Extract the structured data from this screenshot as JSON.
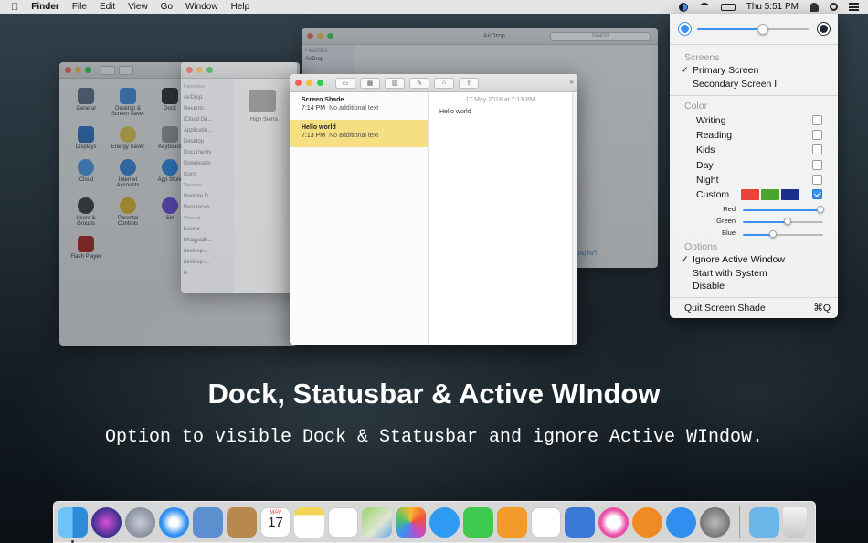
{
  "menubar": {
    "apple": "",
    "app_name": "Finder",
    "menus": [
      "File",
      "Edit",
      "View",
      "Go",
      "Window",
      "Help"
    ],
    "battery": "",
    "clock": "Thu 5:51 PM",
    "status_icons": [
      "screen-shade-icon",
      "wifi-icon",
      "battery-icon",
      "user-icon",
      "search-icon",
      "list-icon"
    ]
  },
  "bg_windows": {
    "sysprefs": {
      "items": [
        "General",
        "Desktop & Screen Saver",
        "Dock",
        "Displays",
        "Energy Saver",
        "Keyboard",
        "iCloud",
        "Internet Accounts",
        "App Store",
        "Users & Groups",
        "Parental Controls",
        "Siri",
        "Flash Player"
      ]
    },
    "finder": {
      "favorites_header": "Favorites",
      "favorites": [
        "AirDrop",
        "Recents",
        "iCloud Dri...",
        "Applicatio...",
        "Desktop",
        "Documents",
        "Downloads",
        "Icons"
      ],
      "devices_header": "Devices",
      "devices": [
        "Remote D...",
        "Resources"
      ],
      "shared_header": "Shared",
      "shared": [
        "baskar",
        "bhagyadh...",
        "desktop-...",
        "desktop-...",
        "ili"
      ],
      "content_item": "High Sierra"
    },
    "airdrop": {
      "title": "AirDrop",
      "search_placeholder": "Search",
      "favorites_header": "Favorites",
      "favorites_first": "AirDrop",
      "footer_link": "looking for?"
    }
  },
  "notes": {
    "toolbar_icons": [
      "sidebar-toggle-icon",
      "gallery-icon",
      "trash-icon",
      "compose-icon",
      "lock-icon",
      "share-icon"
    ],
    "expand_icon": "»",
    "list": [
      {
        "title": "Screen Shade",
        "time": "7:14 PM",
        "preview": "No additional text",
        "selected": false
      },
      {
        "title": "Hello world",
        "time": "7:13 PM",
        "preview": "No additional text",
        "selected": true
      }
    ],
    "date": "17 May 2018 at 7:13 PM",
    "body": "Hello world"
  },
  "shade_menu": {
    "screens_header": "Screens",
    "primary_screen": "Primary Screen",
    "secondary_screen": "Secondary Screen I",
    "color_header": "Color",
    "colors": [
      {
        "label": "Writing",
        "checked": false
      },
      {
        "label": "Reading",
        "checked": false
      },
      {
        "label": "Kids",
        "checked": false
      },
      {
        "label": "Day",
        "checked": false
      },
      {
        "label": "Night",
        "checked": false
      },
      {
        "label": "Custom",
        "checked": true
      }
    ],
    "custom_swatches": [
      "#e8443a",
      "#4aa52e",
      "#1a2f8c"
    ],
    "brightness": 0.6,
    "sliders": [
      {
        "label": "Red",
        "value": 1.0
      },
      {
        "label": "Green",
        "value": 0.55
      },
      {
        "label": "Blue",
        "value": 0.37
      }
    ],
    "options_header": "Options",
    "ignore_active_window": "Ignore Active Window",
    "start_with_system": "Start with System",
    "disable": "Disable",
    "quit": "Quit Screen Shade",
    "quit_shortcut": "⌘Q",
    "check_mark": "✓"
  },
  "headline": "Dock, Statusbar & Active WIndow",
  "subline": "Option to visible Dock & Statusbar and ignore Active WIndow.",
  "dock": {
    "apps": [
      "finder-icon",
      "siri-icon",
      "launchpad-icon",
      "safari-icon",
      "mail-icon",
      "contacts-icon",
      "calendar-icon",
      "notes-icon",
      "reminders-icon",
      "maps-icon",
      "photos-icon",
      "messages-icon",
      "facetime-icon",
      "pages-icon",
      "numbers-icon",
      "keynote-icon",
      "itunes-icon",
      "ibooks-icon",
      "app-store-icon",
      "system-preferences-icon"
    ],
    "calendar_month": "MAY",
    "calendar_day": "17",
    "trailing": [
      "downloads-folder-icon",
      "trash-icon"
    ]
  }
}
